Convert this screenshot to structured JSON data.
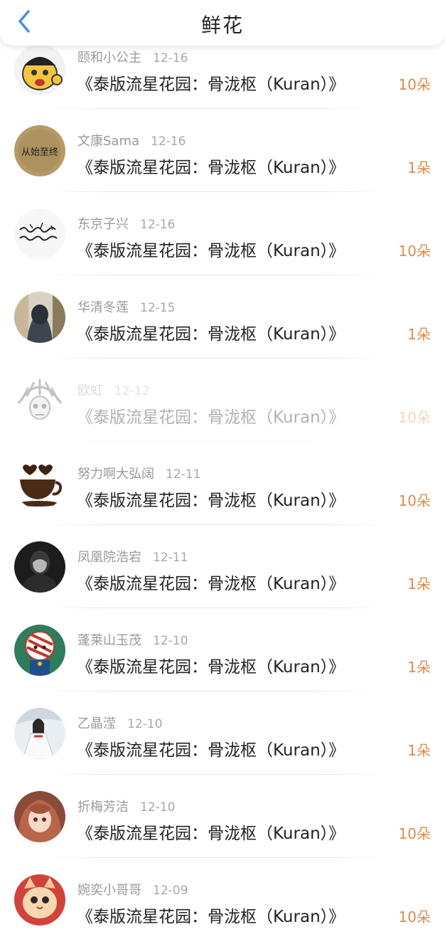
{
  "header": {
    "title": "鲜花",
    "back_icon": "chevron-left-icon",
    "accent": "#4a90e2"
  },
  "colors": {
    "count": "#e08a4a",
    "name": "#9a9a9a",
    "book": "#222222"
  },
  "entries": [
    {
      "name": "颐和小公主",
      "date": "12-16",
      "book": "《泰版流星花园：骨泷枢（Kuran）》",
      "count": "10朵",
      "faded": false
    },
    {
      "name": "文康Sama",
      "date": "12-16",
      "book": "《泰版流星花园：骨泷枢（Kuran）》",
      "count": "1朵",
      "faded": false
    },
    {
      "name": "东京子兴",
      "date": "12-16",
      "book": "《泰版流星花园：骨泷枢（Kuran）》",
      "count": "10朵",
      "faded": false
    },
    {
      "name": "华清冬莲",
      "date": "12-15",
      "book": "《泰版流星花园：骨泷枢（Kuran）》",
      "count": "1朵",
      "faded": false
    },
    {
      "name": "欧虹",
      "date": "12-12",
      "book": "《泰版流星花园：骨泷枢（Kuran）》",
      "count": "10朵",
      "faded": true
    },
    {
      "name": "努力啊大弘阔",
      "date": "12-11",
      "book": "《泰版流星花园：骨泷枢（Kuran）》",
      "count": "10朵",
      "faded": false
    },
    {
      "name": "凤凰院浩宕",
      "date": "12-11",
      "book": "《泰版流星花园：骨泷枢（Kuran）》",
      "count": "1朵",
      "faded": false
    },
    {
      "name": "蓬莱山玉茂",
      "date": "12-10",
      "book": "《泰版流星花园：骨泷枢（Kuran）》",
      "count": "1朵",
      "faded": false
    },
    {
      "name": "乙晶滢",
      "date": "12-10",
      "book": "《泰版流星花园：骨泷枢（Kuran）》",
      "count": "1朵",
      "faded": false
    },
    {
      "name": "折梅芳洁",
      "date": "12-10",
      "book": "《泰版流星花园：骨泷枢（Kuran）》",
      "count": "10朵",
      "faded": false
    },
    {
      "name": "婉奕小哥哥",
      "date": "12-09",
      "book": "《泰版流星花园：骨泷枢（Kuran）》",
      "count": "10朵",
      "faded": false
    }
  ],
  "avatars": [
    {
      "icon": "cartoon-face-avatar-icon"
    },
    {
      "icon": "calligraphy-avatar-icon",
      "text": "从始至终"
    },
    {
      "icon": "handwriting-avatar-icon"
    },
    {
      "icon": "hooded-person-avatar-icon"
    },
    {
      "icon": "skull-headdress-avatar-icon"
    },
    {
      "icon": "coffee-cup-avatar-icon"
    },
    {
      "icon": "dark-figure-avatar-icon"
    },
    {
      "icon": "cartoon-character-avatar-icon"
    },
    {
      "icon": "girl-in-dress-avatar-icon"
    },
    {
      "icon": "anime-girl-avatar-icon"
    },
    {
      "icon": "cat-avatar-icon"
    }
  ]
}
